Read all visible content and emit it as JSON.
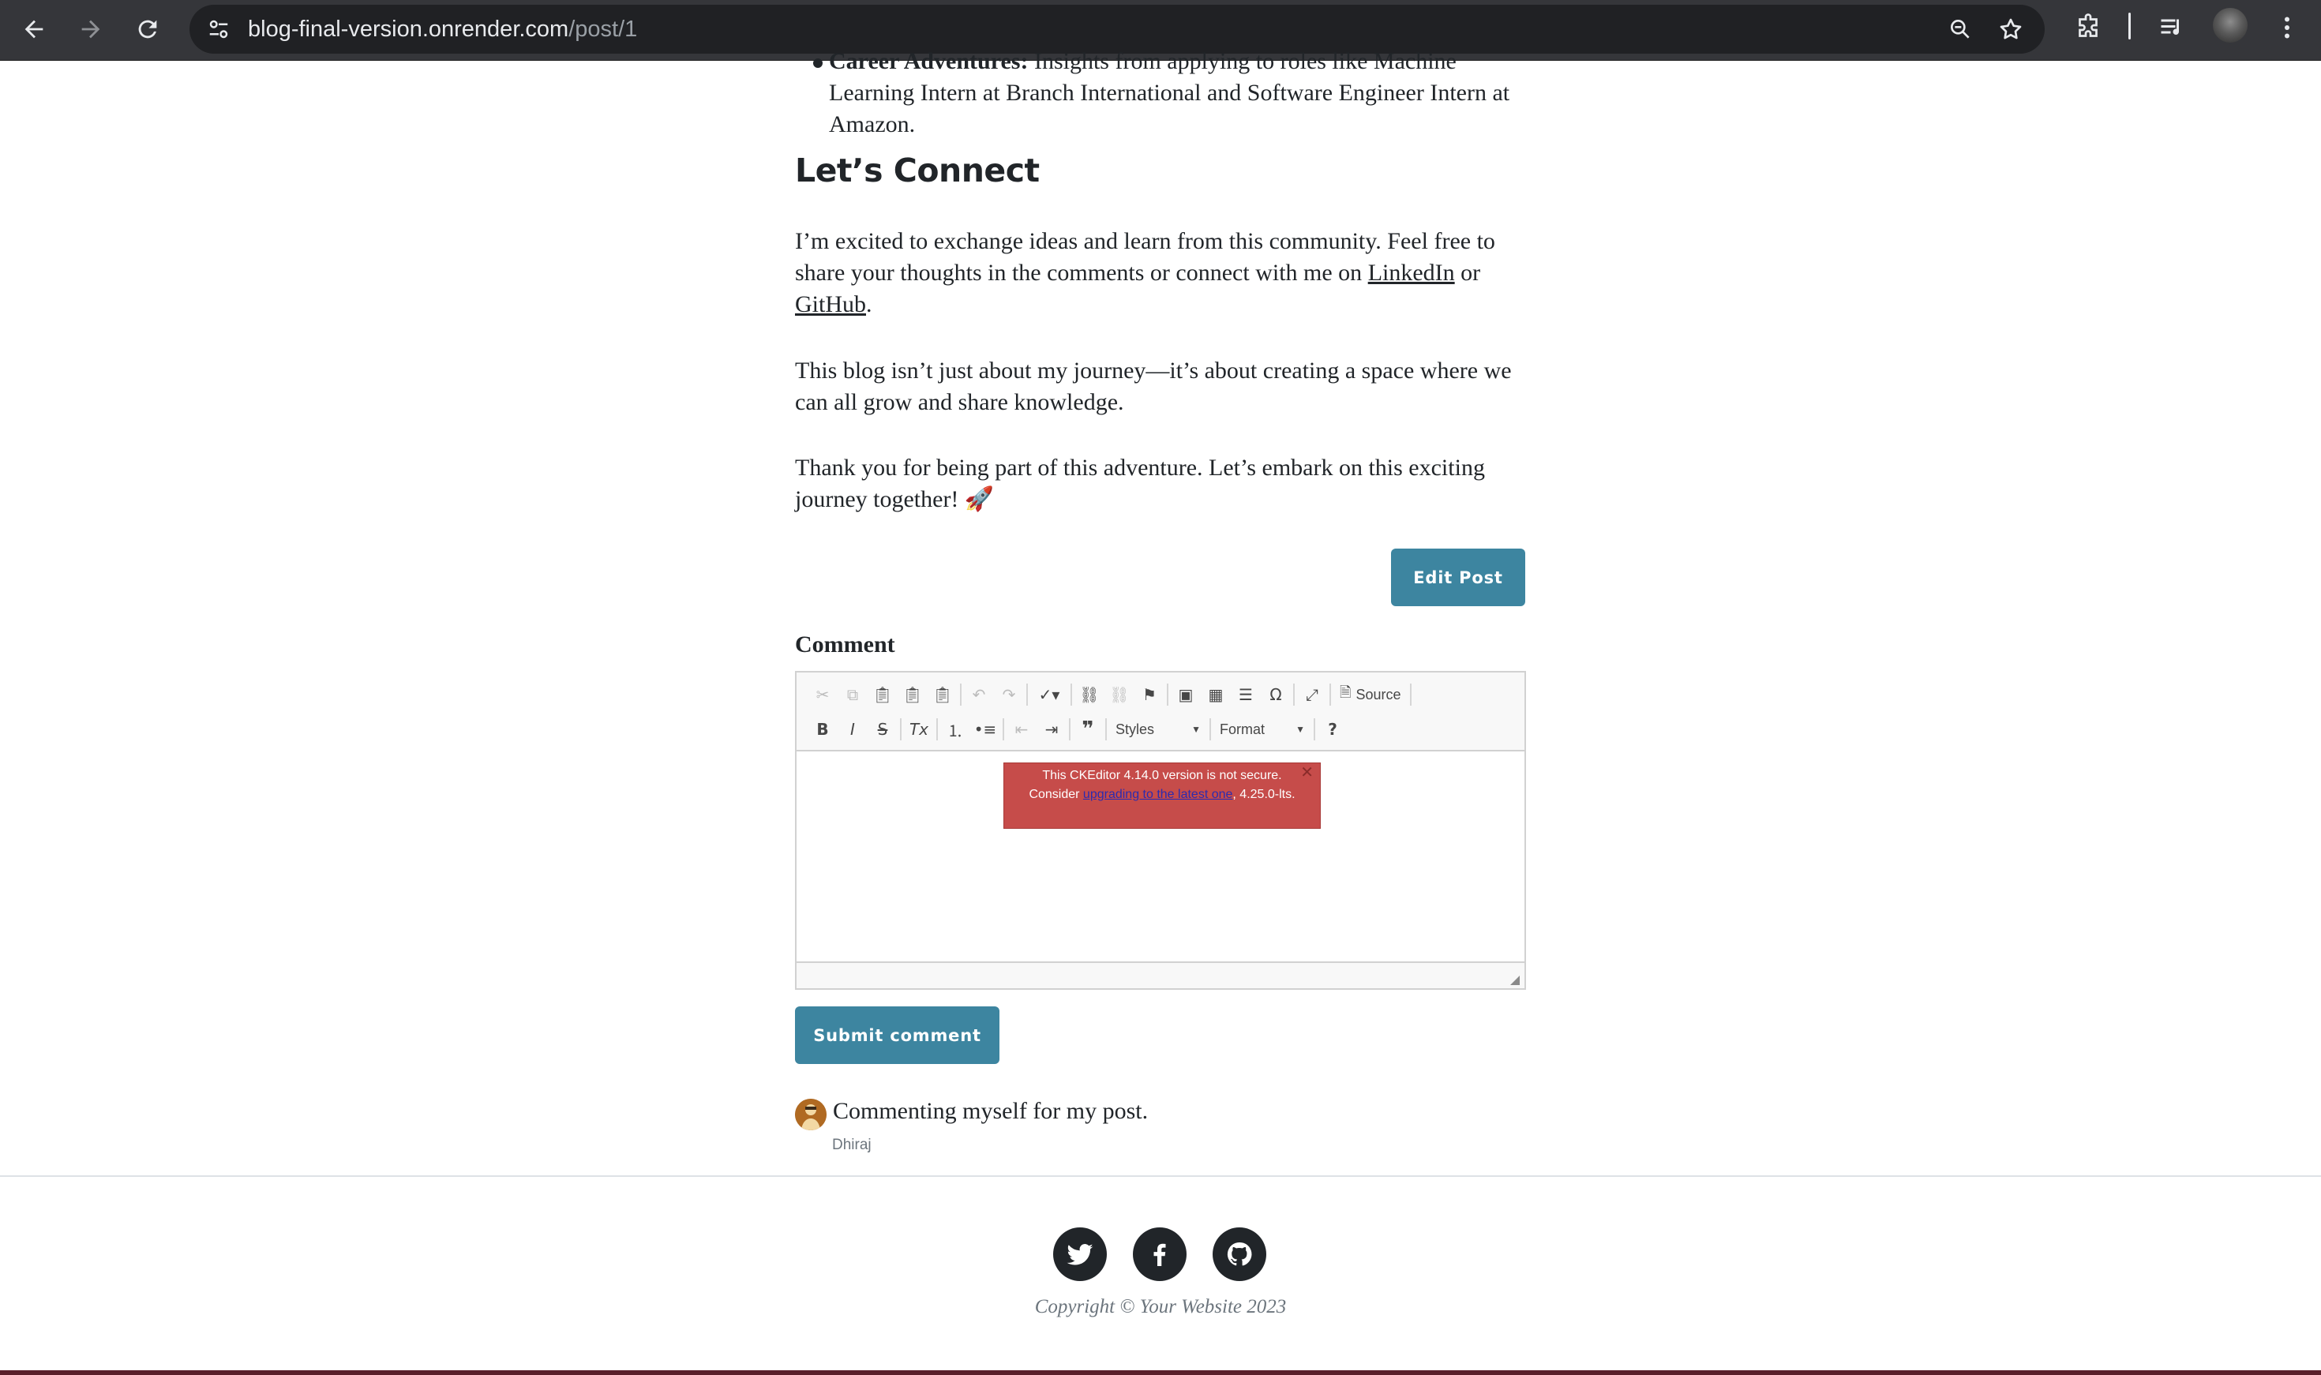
{
  "browser": {
    "url_host": "blog-final-version.onrender.com",
    "url_path": "/post/1"
  },
  "post": {
    "list_item_bold": "Career Adventures:",
    "list_item_text": " Insights from applying to roles like Machine Learning Intern at Branch International and Software Engineer Intern at Amazon.",
    "connect_heading": "Let’s Connect",
    "para1_before": "I’m excited to exchange ideas and learn from this community. Feel free to share your thoughts in the comments or connect with me on ",
    "para1_link1": "LinkedIn",
    "para1_mid": " or ",
    "para1_link2": "GitHub",
    "para1_after": ".",
    "para2": "This blog isn’t just about my journey—it’s about creating a space where we can all grow and share knowledge.",
    "para3": "Thank you for being part of this adventure. Let’s embark on this exciting journey together! 🚀",
    "edit_button": "Edit Post"
  },
  "comment_form": {
    "label": "Comment",
    "toolbar": {
      "source_label": "Source",
      "styles_label": "Styles",
      "format_label": "Format"
    },
    "warning": {
      "line1": "This CKEditor 4.14.0 version is not secure. Consider ",
      "link": "upgrading to the latest one",
      "line2": ", 4.25.0-lts.",
      "close": "✕"
    },
    "submit_button": "Submit comment"
  },
  "comments": [
    {
      "text": "Commenting myself for my post.",
      "author": "Dhiraj"
    }
  ],
  "footer": {
    "social": [
      "twitter-icon",
      "facebook-icon",
      "github-icon"
    ],
    "copyright": "Copyright © Your Website 2023"
  },
  "colors": {
    "accent": "#3d85a0",
    "warning_bg": "#c64c4a",
    "chrome_bg": "#35363a"
  }
}
